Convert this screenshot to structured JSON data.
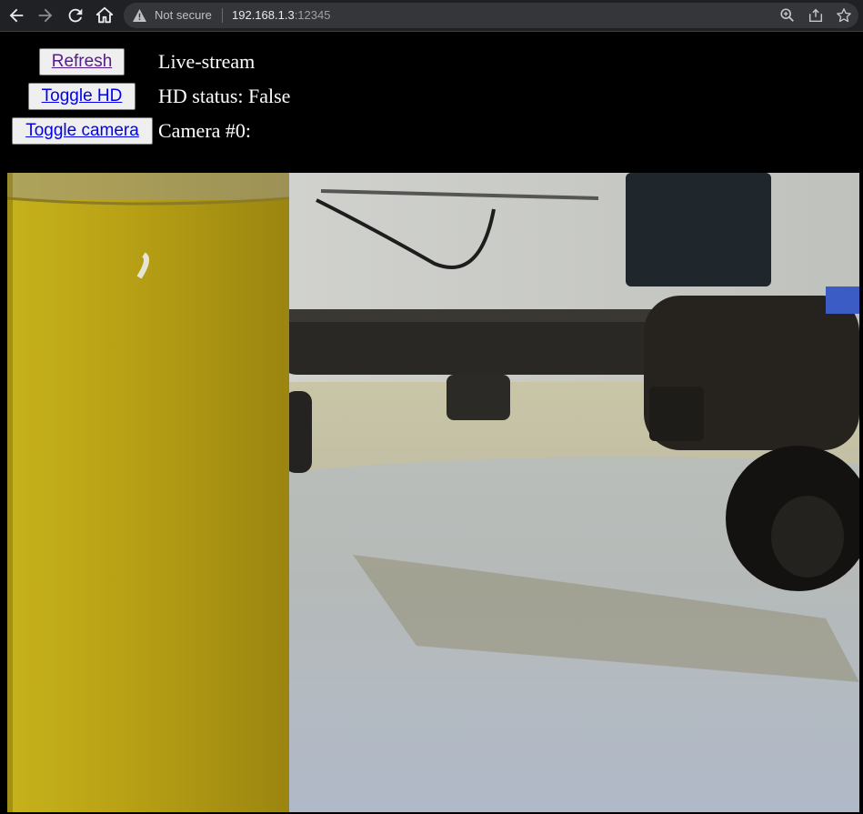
{
  "browser": {
    "security_label": "Not secure",
    "url_host": "192.168.1.3",
    "url_port": ":12345",
    "icons": [
      "back-arrow-icon",
      "forward-arrow-icon",
      "reload-icon",
      "home-icon",
      "warning-icon",
      "zoom-icon",
      "share-icon",
      "bookmark-star-icon"
    ]
  },
  "controls": {
    "refresh_label": "Refresh",
    "toggle_hd_label": "Toggle HD",
    "toggle_camera_label": "Toggle camera"
  },
  "status": {
    "stream_title": "Live-stream",
    "hd_status": "HD status: False",
    "camera_label": "Camera #0:"
  }
}
